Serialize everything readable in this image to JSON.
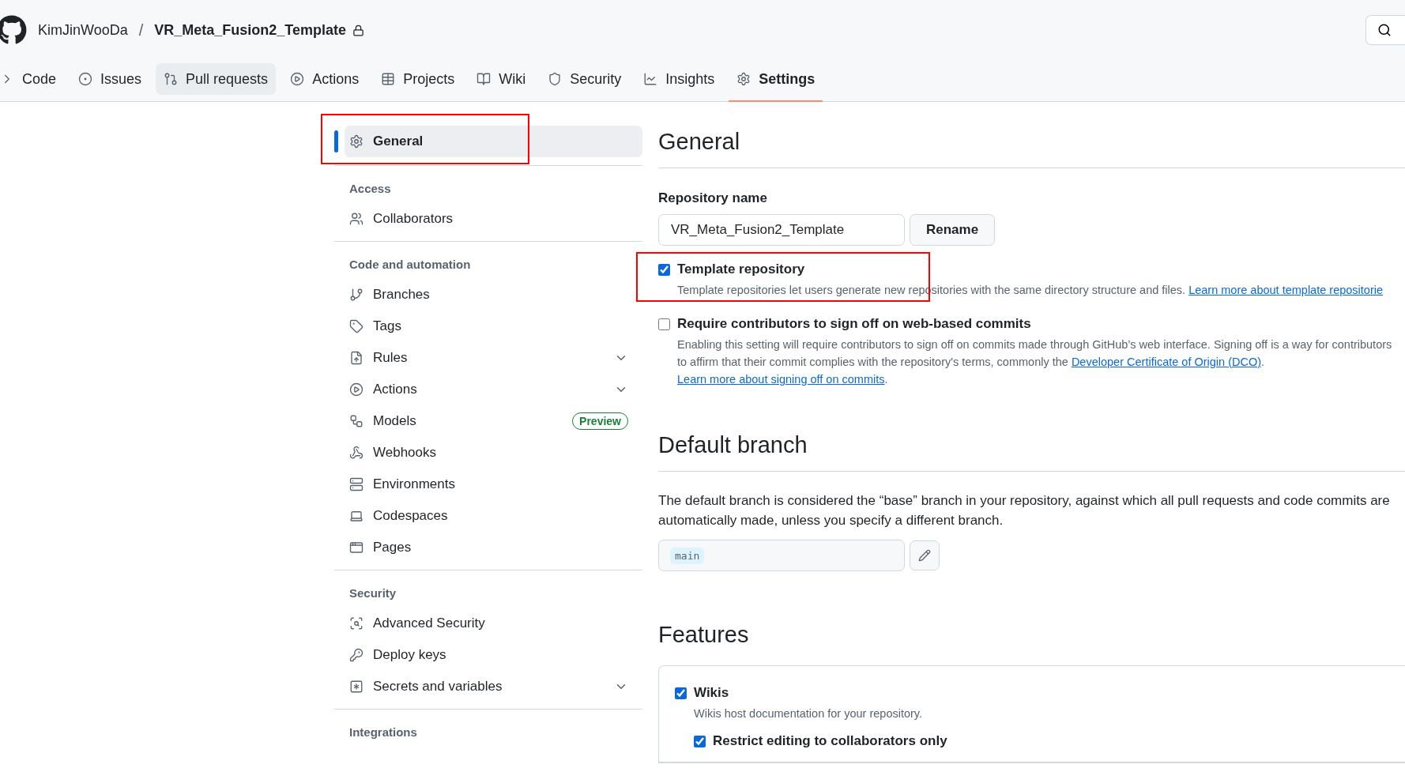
{
  "header": {
    "owner": "KimJinWooDa",
    "separator": "/",
    "repo": "VR_Meta_Fusion2_Template",
    "private": true
  },
  "tabs": [
    {
      "label": "Code",
      "selected": false,
      "hovered": false
    },
    {
      "label": "Issues",
      "selected": false,
      "hovered": false
    },
    {
      "label": "Pull requests",
      "selected": false,
      "hovered": true
    },
    {
      "label": "Actions",
      "selected": false,
      "hovered": false
    },
    {
      "label": "Projects",
      "selected": false,
      "hovered": false
    },
    {
      "label": "Wiki",
      "selected": false,
      "hovered": false
    },
    {
      "label": "Security",
      "selected": false,
      "hovered": false
    },
    {
      "label": "Insights",
      "selected": false,
      "hovered": false
    },
    {
      "label": "Settings",
      "selected": true,
      "hovered": false
    }
  ],
  "sidebar": {
    "sections": [
      {
        "items": [
          {
            "label": "General",
            "selected": true
          }
        ]
      },
      {
        "heading": "Access",
        "items": [
          {
            "label": "Collaborators",
            "selected": false
          }
        ]
      },
      {
        "heading": "Code and automation",
        "items": [
          {
            "label": "Branches",
            "selected": false
          },
          {
            "label": "Tags",
            "selected": false
          },
          {
            "label": "Rules",
            "selected": false,
            "expandable": true
          },
          {
            "label": "Actions",
            "selected": false,
            "expandable": true
          },
          {
            "label": "Models",
            "selected": false,
            "badge": "Preview"
          },
          {
            "label": "Webhooks",
            "selected": false
          },
          {
            "label": "Environments",
            "selected": false
          },
          {
            "label": "Codespaces",
            "selected": false
          },
          {
            "label": "Pages",
            "selected": false
          }
        ]
      },
      {
        "heading": "Security",
        "items": [
          {
            "label": "Advanced Security",
            "selected": false
          },
          {
            "label": "Deploy keys",
            "selected": false
          },
          {
            "label": "Secrets and variables",
            "selected": false,
            "expandable": true
          }
        ]
      },
      {
        "heading": "Integrations"
      }
    ]
  },
  "general": {
    "title": "General",
    "repo_name_label": "Repository name",
    "repo_name_value": "VR_Meta_Fusion2_Template",
    "rename_button": "Rename",
    "options": [
      {
        "label": "Template repository",
        "checked": true,
        "description": [
          {
            "text": "Template repositories let users generate new repositories with the same directory structure and files. "
          },
          {
            "text": "Learn more about template repositorie",
            "link": true
          }
        ]
      },
      {
        "label": "Require contributors to sign off on web-based commits",
        "checked": false,
        "description": [
          {
            "text": "Enabling this setting will require contributors to sign off on commits made through GitHub’s web interface. Signing off is a way for contributors to affirm that their commit complies with the repository's terms, commonly the "
          },
          {
            "text": "Developer Certificate of Origin (DCO)",
            "link": true
          },
          {
            "text": ". "
          },
          {
            "text": "Learn more about signing off on commits",
            "link": true
          },
          {
            "text": "."
          }
        ]
      }
    ]
  },
  "default_branch": {
    "title": "Default branch",
    "description": "The default branch is considered the “base” branch in your repository, against which all pull requests and code commits are automatically made, unless you specify a different branch.",
    "branch": "main"
  },
  "features": {
    "title": "Features",
    "items": [
      {
        "label": "Wikis",
        "checked": true,
        "description": "Wikis host documentation for your repository.",
        "children": [
          {
            "label": "Restrict editing to collaborators only",
            "checked": true
          }
        ]
      }
    ]
  }
}
